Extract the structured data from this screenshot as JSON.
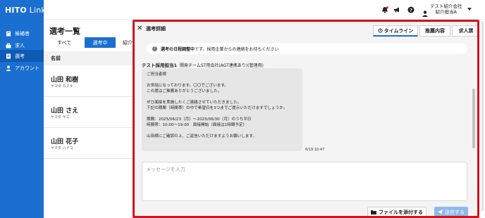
{
  "app": {
    "logo_bold": "HITO",
    "logo_light": " Link"
  },
  "sidebar": {
    "items": [
      {
        "label": "候補者",
        "icon": "candidates-icon"
      },
      {
        "label": "求人",
        "icon": "job-icon"
      },
      {
        "label": "選考",
        "icon": "selection-icon",
        "active": true
      },
      {
        "label": "アカウント",
        "icon": "account-icon"
      }
    ]
  },
  "topbar": {
    "user_company": "テスト紹介会社",
    "user_role": "紹介担当A"
  },
  "list": {
    "title": "選考一覧",
    "tabs": [
      "すべて",
      "選考中",
      "紹介"
    ],
    "column_header": "名前",
    "candidates": [
      {
        "name": "山田 和樹",
        "kana": "ヤマダ カズキ"
      },
      {
        "name": "山田 さえ",
        "kana": "ヤマダ サエ"
      },
      {
        "name": "山田 花子",
        "kana": "ヤマダ ハナコ"
      }
    ]
  },
  "modal": {
    "title": "選考詳細",
    "tabs": [
      "タイムライン",
      "推薦内容",
      "求人票"
    ],
    "notice_bold": "選考の日程調整中",
    "notice_rest": "です。採用企業からの連絡をお待ちください",
    "sender_name": "テスト採用担当1",
    "sender_org": "開発チームST用会社(AGT連携あり)(管理用)",
    "message_lines": [
      "ご担当者様",
      "",
      "お世話になっております。〇〇でございます。",
      "この度はご推薦ありがとうございました。",
      "",
      "ぜひ面接を実施したくご連絡させていただきました。",
      "下記の期間（時間帯）の中で希望日を3つまでご提示いただけますでしょうか。",
      "",
      "期間：2025/06/23（月）〜2025/06/30（月）のうち平日",
      "時間帯：10:00〜19:00　面接開始（面接は1時間予定）",
      "",
      "山田様にご確認の上、ご返信いただけますようお願いします。"
    ],
    "message_time": "6/19 10:47",
    "input_placeholder": "メッセージを入力",
    "attach_label": "ファイルを添付する",
    "send_label": "送信する"
  },
  "colors": {
    "brand_blue": "#1a6fd0",
    "highlight_red": "#d0141d",
    "send_disabled": "#8fb8ea"
  }
}
